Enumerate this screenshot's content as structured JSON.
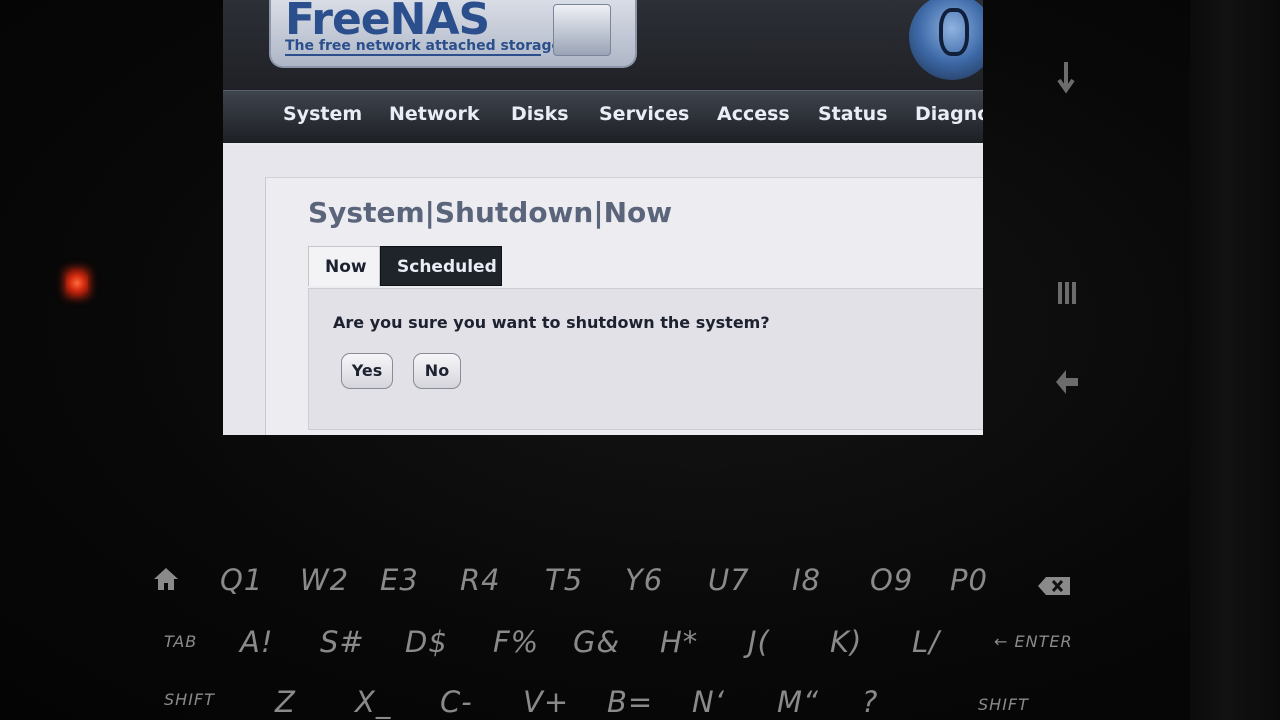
{
  "logo": {
    "name": "FreeNAS",
    "tagline": "The free network attached storage"
  },
  "nav": {
    "items": [
      "System",
      "Network",
      "Disks",
      "Services",
      "Access",
      "Status",
      "Diagno"
    ]
  },
  "page": {
    "title": "System|Shutdown|Now",
    "tabs": [
      "Now",
      "Scheduled"
    ],
    "question": "Are you sure you want to shutdown the system?",
    "yes_label": "Yes",
    "no_label": "No"
  },
  "keyboard": {
    "row1": [
      "Q1",
      "W2",
      "E3",
      "R4",
      "T5",
      "Y6",
      "U7",
      "I8",
      "O9",
      "P0"
    ],
    "row2": [
      "A!",
      "S#",
      "D$",
      "F%",
      "G&",
      "H*",
      "J(",
      "K)",
      "L/"
    ],
    "row3": [
      "Z",
      "X_",
      "C-",
      "V+",
      "B=",
      "N‘",
      "M“",
      "?"
    ],
    "tab": "TAB",
    "enter": "ENTER",
    "shift_left": "SHIFT",
    "shift_right": "SHIFT"
  },
  "icons": {
    "home": "home-icon",
    "backspace": "backspace-icon",
    "enter_arrow": "enter-arrow-icon",
    "menu": "menu-icon",
    "back": "back-arrow-icon",
    "down": "down-arrow-icon"
  },
  "colors": {
    "nav_bg": "#1c1f24",
    "logo_text": "#2b4f8c",
    "active_tab": "#1f232a"
  }
}
